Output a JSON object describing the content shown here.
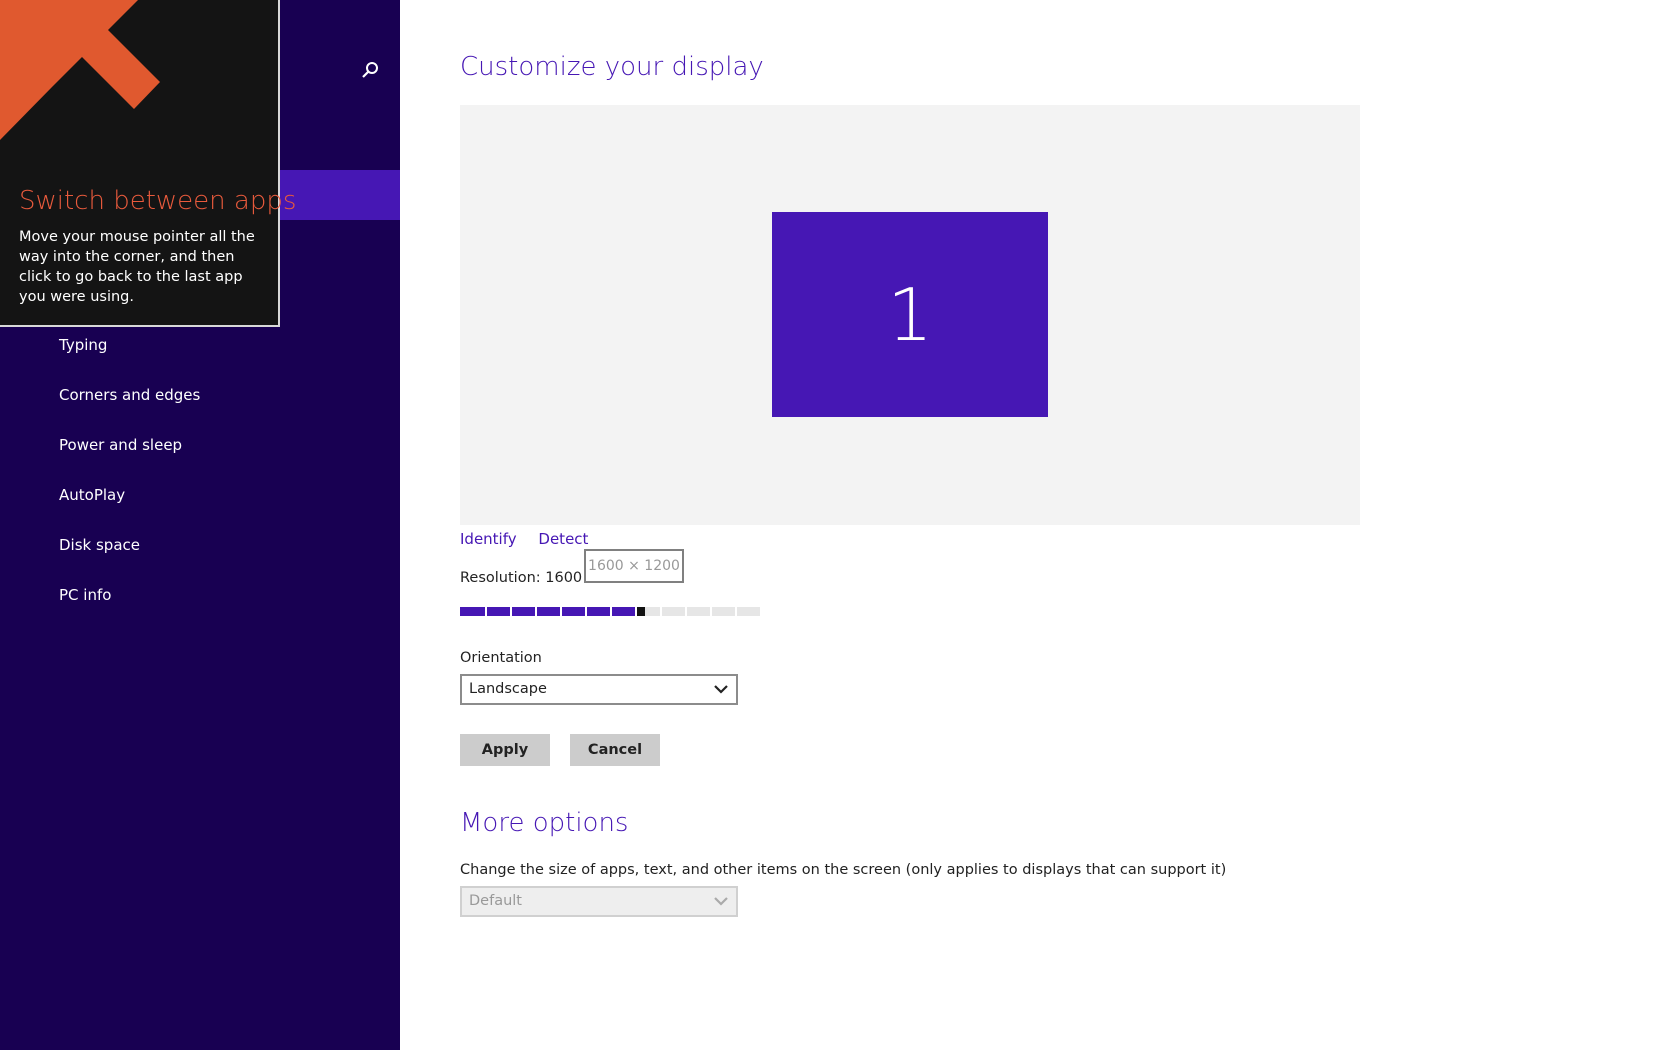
{
  "sidebar": {
    "items": [
      {
        "label": "Typing"
      },
      {
        "label": "Corners and edges"
      },
      {
        "label": "Power and sleep"
      },
      {
        "label": "AutoPlay"
      },
      {
        "label": "Disk space"
      },
      {
        "label": "PC info"
      }
    ]
  },
  "tip": {
    "title": "Switch between apps",
    "text": "Move your mouse pointer all the way into the corner, and then click to go back to the last app you were using."
  },
  "display": {
    "title": "Customize your display",
    "monitor_number": "1",
    "identify_label": "Identify",
    "detect_label": "Detect",
    "resolution_label": "Resolution: 1600 × 1200",
    "resolution_tooltip": "1600 × 1200",
    "resolution_level": 0.6,
    "orientation_label": "Orientation",
    "orientation_value": "Landscape",
    "apply_label": "Apply",
    "cancel_label": "Cancel"
  },
  "more_options": {
    "title": "More options",
    "scale_label": "Change the size of apps, text, and other items on the screen (only applies to displays that can support it)",
    "scale_value": "Default"
  },
  "colors": {
    "accent": "#4617b4",
    "sidebar_bg": "#180052",
    "tip_title": "#e85a3c",
    "arrow": "#e0592f"
  }
}
